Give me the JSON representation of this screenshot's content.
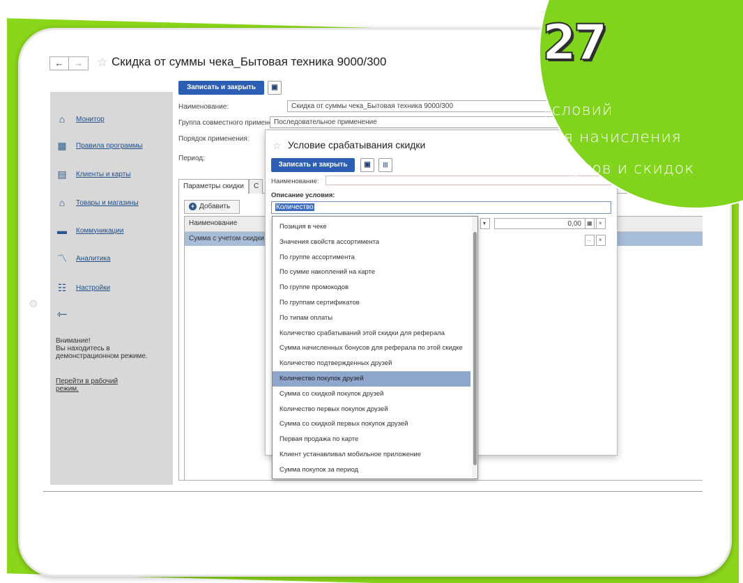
{
  "window": {
    "title": "Скидка от суммы чека_Бытовая техника 9000/300",
    "back_label": "←",
    "forward_label": "→",
    "star": "☆"
  },
  "sidebar": {
    "items": [
      {
        "label": "Монитор",
        "icon": "home-icon",
        "glyph": "⌂"
      },
      {
        "label": "Правила программы",
        "icon": "grid-icon",
        "glyph": "▦"
      },
      {
        "label": "Клиенты и карты",
        "icon": "id-card-icon",
        "glyph": "▤"
      },
      {
        "label": "Товары и магазины",
        "icon": "basket-icon",
        "glyph": "⌂"
      },
      {
        "label": "Коммуникации",
        "icon": "chat-icon",
        "glyph": "▬"
      },
      {
        "label": "Аналитика",
        "icon": "chart-icon",
        "glyph": "〽"
      },
      {
        "label": "Настройки",
        "icon": "sliders-icon",
        "glyph": "☷"
      }
    ],
    "collapse_glyph": "⇽",
    "warning": "Внимание!\nВы находитесь в демонстрационном режиме.",
    "warning_link": "Перейти в рабочий режим."
  },
  "form": {
    "save_close_label": "Записать и закрыть",
    "save_icon": "💾",
    "name_label": "Наименование:",
    "name_value": "Скидка от суммы чека_Бытовая техника 9000/300",
    "group_label": "Группа совместного применения:",
    "group_value": "Последовательное применение",
    "order_label": "Порядок применения:",
    "period_label": "Период:",
    "tabs": [
      "Параметры скидки",
      "С"
    ],
    "add_label": "Добавить",
    "grid_header": "Наименование",
    "grid_row": "Сумма с учетом скидки"
  },
  "modal": {
    "title": "Условие срабатывания скидки",
    "save_close_label": "Записать и закрыть",
    "name_label": "Наименование:",
    "condition_label": "Описание условия:",
    "condition_value": "Количество",
    "amount_value": "0,00",
    "clear_glyph": "×",
    "more_glyph": "...",
    "options": [
      "Позиция в чеке",
      "Значения свойств ассортимента",
      "По группе ассортимента",
      "По сумме накоплений на карте",
      "По группе промокодов",
      "По группам сертификатов",
      "По типам оплаты",
      "Количество срабатываний этой скидки для реферала",
      "Сумма начисленных бонусов для реферала по этой скидке",
      "Количество подтвержденных друзей",
      "Количество покупок друзей",
      "Сумма со скидкой покупок друзей",
      "Количество первых покупок друзей",
      "Сумма со скидкой первых покупок друзей",
      "Первая продажа по карте",
      "Клиент устанавливал мобильное приложение",
      "Сумма покупок за период"
    ],
    "selected_index": 10
  },
  "badge": {
    "number": "27",
    "line1": "условий",
    "line2": "для начисления",
    "line3": "бонусов и скидок",
    "color": "#80d41c"
  }
}
